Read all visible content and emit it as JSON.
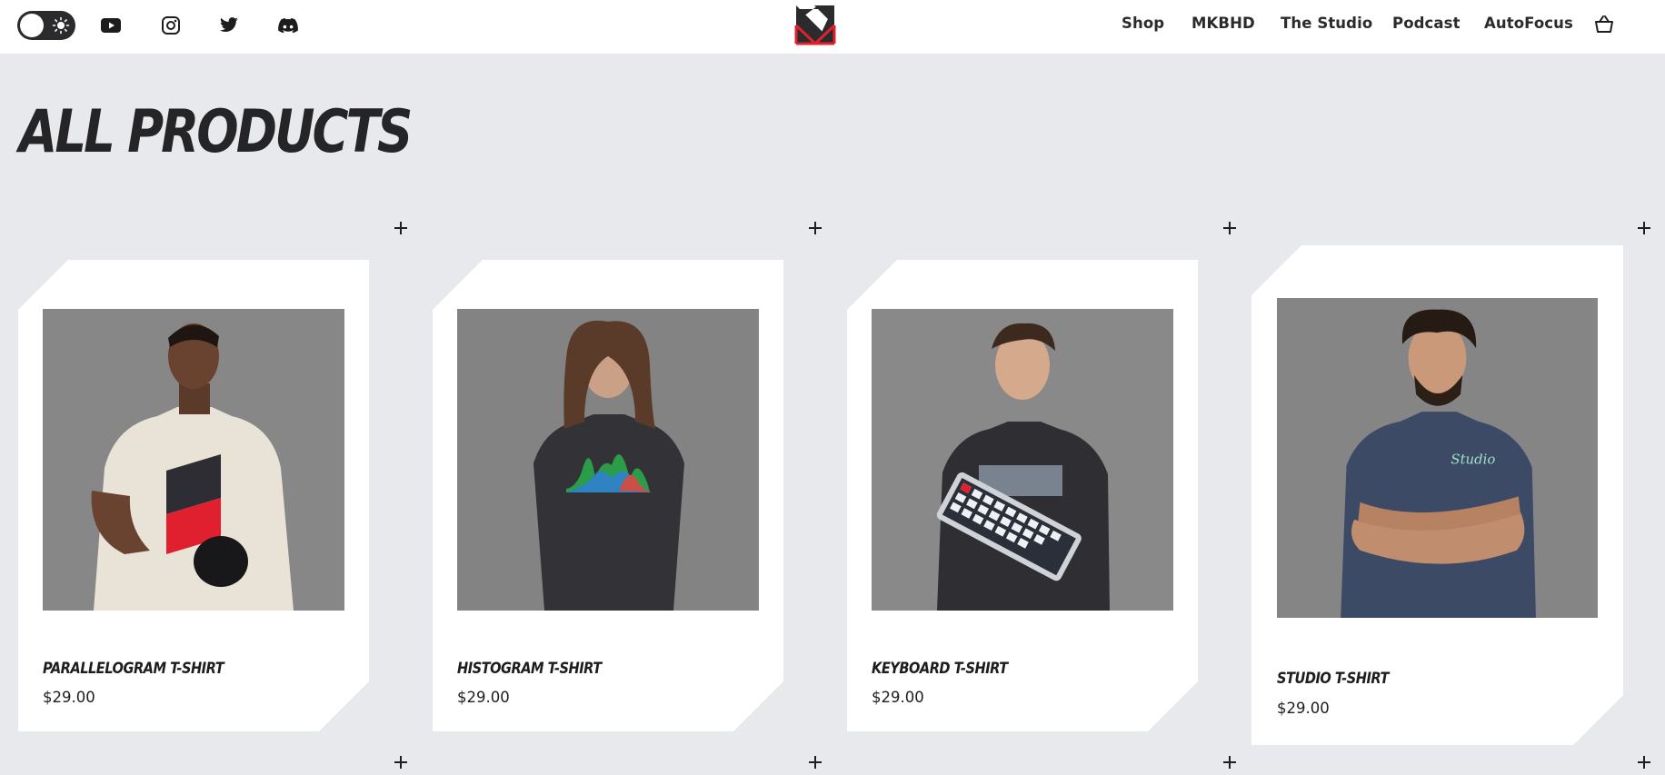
{
  "header": {
    "theme_toggle": "light",
    "social": [
      "youtube-icon",
      "instagram-icon",
      "twitter-icon",
      "discord-icon"
    ],
    "nav": [
      "Shop",
      "MKBHD",
      "The Studio",
      "Podcast",
      "AutoFocus"
    ],
    "colors": {
      "brand_red": "#e0202e",
      "brand_dark": "#2b2b2e"
    }
  },
  "page": {
    "title": "ALL PRODUCTS"
  },
  "products": [
    {
      "name": "PARALLELOGRAM T-SHIRT",
      "price": "$29.00"
    },
    {
      "name": "HISTOGRAM T-SHIRT",
      "price": "$29.00"
    },
    {
      "name": "KEYBOARD T-SHIRT",
      "price": "$29.00"
    },
    {
      "name": "STUDIO T-SHIRT",
      "price": "$29.00"
    }
  ]
}
